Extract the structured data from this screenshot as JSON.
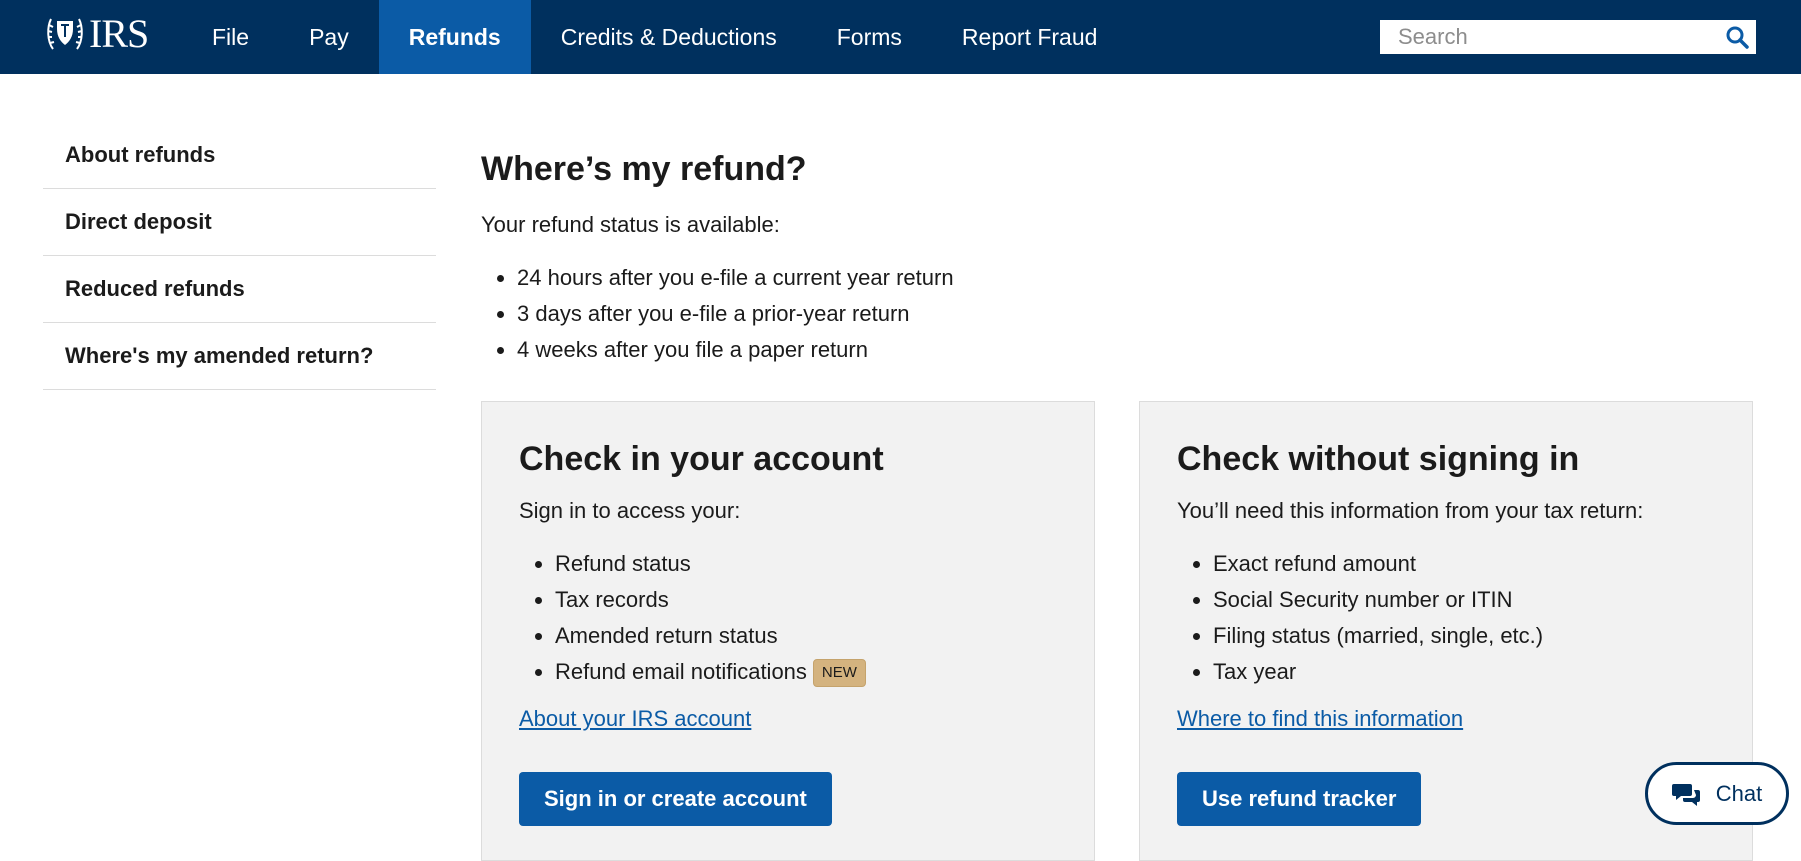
{
  "header": {
    "logo_text": "IRS",
    "nav": [
      {
        "label": "File"
      },
      {
        "label": "Pay"
      },
      {
        "label": "Refunds",
        "active": true
      },
      {
        "label": "Credits & Deductions"
      },
      {
        "label": "Forms"
      },
      {
        "label": "Report Fraud"
      }
    ],
    "search": {
      "placeholder": "Search",
      "value": ""
    }
  },
  "sidebar": {
    "items": [
      {
        "label": "About refunds"
      },
      {
        "label": "Direct deposit"
      },
      {
        "label": "Reduced refunds"
      },
      {
        "label": "Where's my amended return?"
      }
    ]
  },
  "main": {
    "title": "Where’s my refund?",
    "intro": "Your refund status is available:",
    "bullets": [
      "24 hours after you e-file a current year return",
      "3 days after you e-file a prior-year return",
      "4 weeks after you file a paper return"
    ]
  },
  "cards": {
    "account": {
      "title": "Check in your account",
      "lead": "Sign in to access your:",
      "items": [
        "Refund status",
        "Tax records",
        "Amended return status",
        "Refund email notifications"
      ],
      "badge": "NEW",
      "link": "About your IRS account",
      "button": "Sign in or create account"
    },
    "guest": {
      "title": "Check without signing in",
      "lead": "You’ll need this information from your tax return:",
      "items": [
        "Exact refund amount",
        "Social Security number or ITIN",
        "Filing status (married, single, etc.)",
        "Tax year"
      ],
      "link": "Where to find this information",
      "button": "Use refund tracker"
    }
  },
  "chat": {
    "label": "Chat"
  },
  "colors": {
    "header_bg": "#00305e",
    "active_tab": "#0b5ba6",
    "link": "#0b5ba6",
    "card_bg": "#f2f2f2",
    "badge_bg": "#d4b37f"
  },
  "icons": {
    "logo": "eagle-seal-icon",
    "search": "search-icon",
    "chat": "chat-bubbles-icon"
  }
}
